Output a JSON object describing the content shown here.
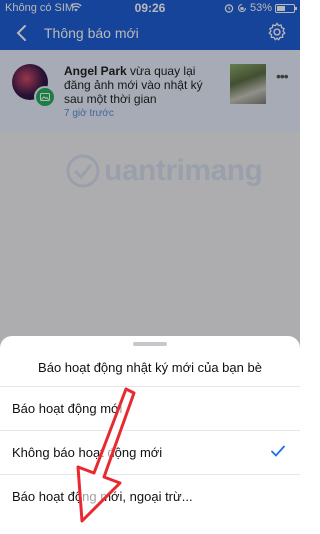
{
  "status_bar": {
    "carrier": "Không có SIM",
    "time": "09:26",
    "battery_percent": "53%",
    "battery_level": 0.53
  },
  "header": {
    "title": "Thông báo mới"
  },
  "notification": {
    "name": "Angel Park",
    "text": " vừa quay lại đăng ảnh mới vào nhật ký sau một thời gian",
    "time": "7 giờ trước"
  },
  "watermark": {
    "text": "uantrimang"
  },
  "sheet": {
    "title": "Báo hoạt động nhật ký mới của bạn bè",
    "options": [
      {
        "label": "Báo hoạt động mới",
        "selected": false
      },
      {
        "label": "Không báo hoạt động mới",
        "selected": true
      },
      {
        "label": "Báo hoạt động mới, ngoại trừ...",
        "selected": false
      }
    ]
  },
  "colors": {
    "header": "#1f5fd6",
    "check": "#1f6fe5",
    "arrow": "#e8292f"
  }
}
